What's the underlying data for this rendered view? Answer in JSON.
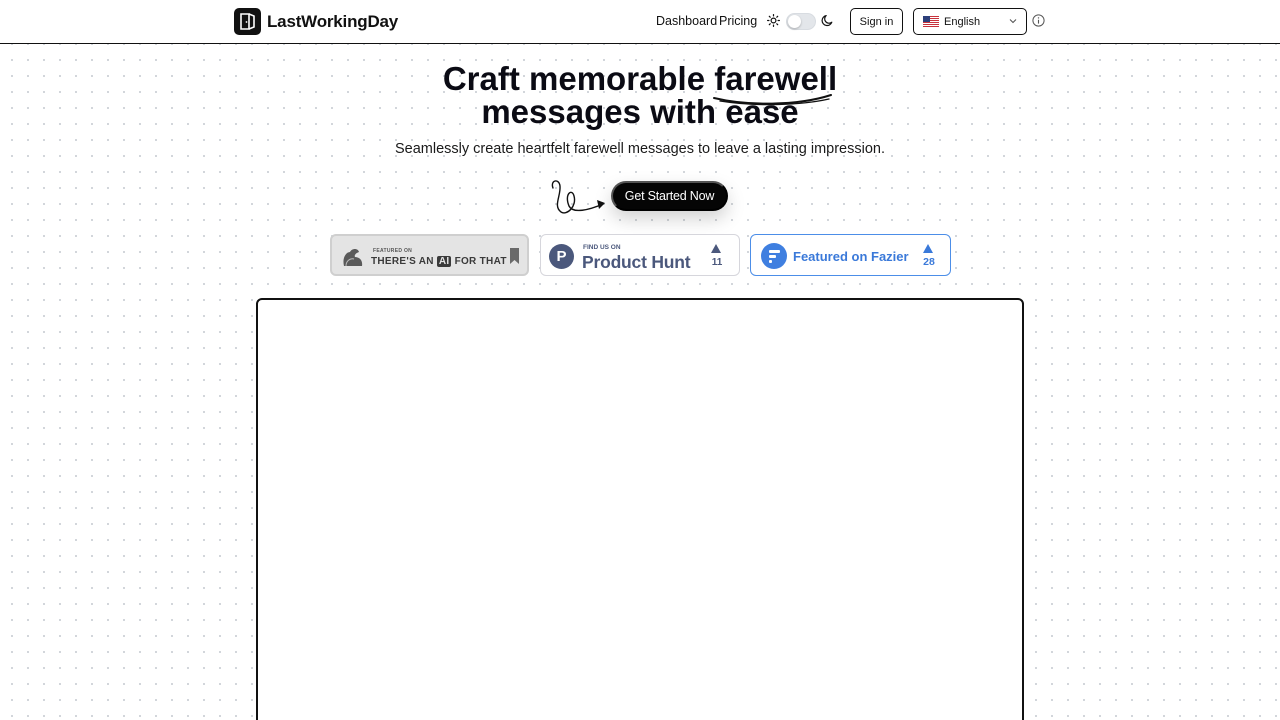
{
  "header": {
    "brand": "LastWorkingDay",
    "nav": {
      "dashboard": "Dashboard",
      "pricing": "Pricing"
    },
    "sign_in": "Sign in",
    "language": {
      "selected": "English",
      "flag": "us-flag"
    },
    "theme_toggle": "light"
  },
  "hero": {
    "title_before": "Craft memorable ",
    "title_highlight": "farewell",
    "title_line2": "messages with ease",
    "subtitle": "Seamlessly create heartfelt farewell messages to leave a lasting impression.",
    "cta": "Get Started Now"
  },
  "badges": {
    "aift": {
      "small": "FEATURED ON",
      "pre": "THERE'S AN ",
      "ai": "AI",
      "post": " FOR THAT"
    },
    "producthunt": {
      "small": "FIND US ON",
      "name": "Product Hunt",
      "letter": "P",
      "count": "11"
    },
    "fazier": {
      "label": "Featured on Fazier",
      "count": "28"
    }
  },
  "colors": {
    "ph_brand": "#4b587c",
    "fazier_brand": "#3a79d9",
    "cta_bg": "#050505"
  }
}
